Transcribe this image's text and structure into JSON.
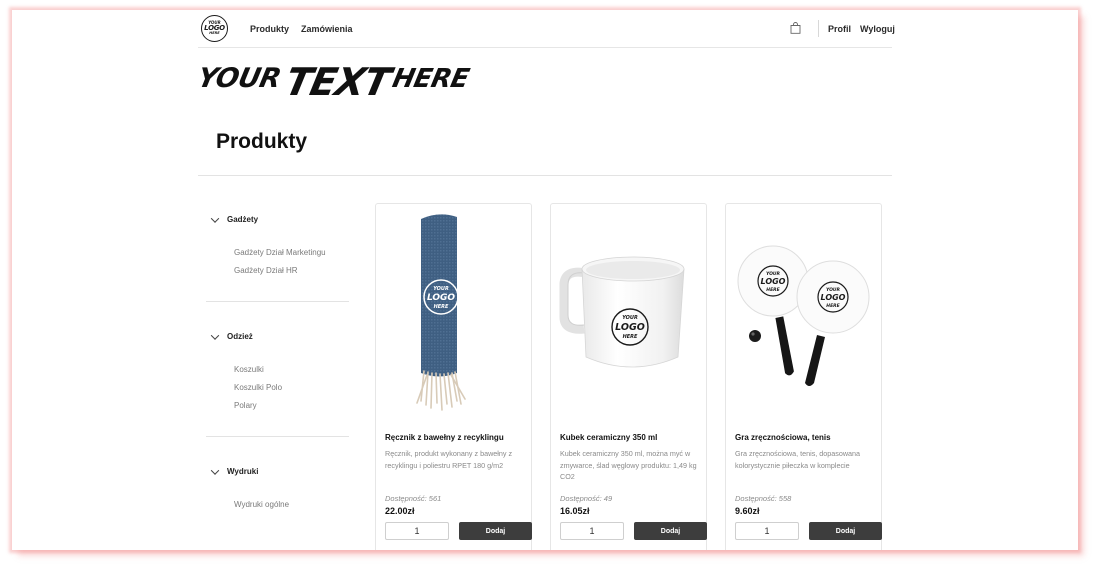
{
  "header": {
    "logo_lines": [
      "YOUR",
      "LOGO",
      "HERE"
    ],
    "nav": [
      "Produkty",
      "Zamówienia"
    ],
    "profile": "Profil",
    "logout": "Wyloguj",
    "cart_icon": "shopping-bag-icon"
  },
  "banner": {
    "w1": "YOUR",
    "w2": "TEXT",
    "w3": "HERE"
  },
  "page_title": "Produkty",
  "sidebar": {
    "categories": [
      {
        "label": "Gadżety",
        "items": [
          "Gadżety Dział Marketingu",
          "Gadżety Dział HR"
        ]
      },
      {
        "label": "Odzież",
        "items": [
          "Koszulki",
          "Koszulki Polo",
          "Polary"
        ]
      },
      {
        "label": "Wydruki",
        "items": [
          "Wydruki ogólne"
        ]
      }
    ]
  },
  "products": [
    {
      "name": "Ręcznik z bawełny z recyklingu",
      "description": "Ręcznik, produkt wykonany z bawełny z recyklingu i poliestru RPET 180 g/m2",
      "stock": "Dostępność: 561",
      "price": "22.00zł",
      "qty": "1",
      "add_label": "Dodaj",
      "image": "towel"
    },
    {
      "name": "Kubek ceramiczny 350 ml",
      "description": "Kubek ceramiczny 350 ml, można myć w zmywarce, ślad węglowy produktu: 1,49 kg CO2",
      "stock": "Dostępność: 49",
      "price": "16.05zł",
      "qty": "1",
      "add_label": "Dodaj",
      "image": "mug"
    },
    {
      "name": "Gra zręcznościowa, tenis",
      "description": "Gra zręcznościowa, tenis, dopasowana kolorystycznie piłeczka w komplecie",
      "stock": "Dostępność: 558",
      "price": "9.60zł",
      "qty": "1",
      "add_label": "Dodaj",
      "image": "paddles"
    }
  ],
  "colors": {
    "button": "#3d3d3d",
    "frame_shadow": "#f07878"
  }
}
